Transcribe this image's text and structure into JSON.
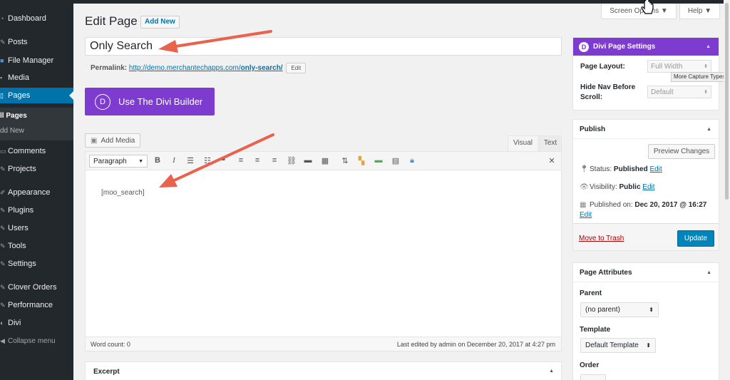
{
  "sidebar": {
    "items": [
      {
        "label": "Dashboard",
        "icon": "dashboard-icon"
      },
      {
        "label": "Posts",
        "icon": "pin-icon"
      },
      {
        "label": "File Manager",
        "icon": "folder-icon"
      },
      {
        "label": "Media",
        "icon": "media-icon"
      },
      {
        "label": "Pages",
        "icon": "pages-icon",
        "active": true
      },
      {
        "label": "Comments",
        "icon": "comment-icon"
      },
      {
        "label": "Projects",
        "icon": "projects-icon"
      },
      {
        "label": "Appearance",
        "icon": "brush-icon"
      },
      {
        "label": "Plugins",
        "icon": "plugin-icon"
      },
      {
        "label": "Users",
        "icon": "users-icon"
      },
      {
        "label": "Tools",
        "icon": "wrench-icon"
      },
      {
        "label": "Settings",
        "icon": "settings-icon"
      },
      {
        "label": "Clover Orders",
        "icon": "clover-icon"
      },
      {
        "label": "Performance",
        "icon": "performance-icon"
      },
      {
        "label": "Divi",
        "icon": "divi-icon"
      },
      {
        "label": "Collapse menu",
        "icon": "collapse-icon"
      }
    ],
    "submenu": [
      "ll Pages",
      "dd New"
    ]
  },
  "header": {
    "title": "Edit Page",
    "add_new": "Add New",
    "screen_options": "Screen Options ▼",
    "help": "Help ▼"
  },
  "post": {
    "title": "Only Search",
    "permalink_label": "Permalink:",
    "permalink_base": "http://demo.merchantechapps.com/",
    "permalink_slug": "only-search/",
    "permalink_edit": "Edit"
  },
  "divi_builder": {
    "logo": "D",
    "label": "Use The Divi Builder"
  },
  "editor": {
    "add_media": "Add Media",
    "tab_visual": "Visual",
    "tab_text": "Text",
    "format_select": "Paragraph",
    "content": "[moo_search]",
    "word_count": "Word count: 0",
    "last_edited": "Last edited by admin on December 20, 2017 at 4:27 pm"
  },
  "excerpt": {
    "title": "Excerpt"
  },
  "divi_settings": {
    "logo": "D",
    "title": "Divi Page Settings",
    "layout_label": "Page Layout:",
    "layout_value": "Full Width",
    "hide_nav_label_1": "Hide Nav Before",
    "hide_nav_label_2": "Scroll:",
    "hide_nav_value": "Default",
    "tooltip": "More Capture Types"
  },
  "publish": {
    "title": "Publish",
    "preview": "Preview Changes",
    "status_label": "Status:",
    "status_value": "Published",
    "visibility_label": "Visibility:",
    "visibility_value": "Public",
    "published_label": "Published on:",
    "published_value": "Dec 20, 2017 @ 16:27",
    "edit": "Edit",
    "trash": "Move to Trash",
    "update": "Update"
  },
  "attributes": {
    "title": "Page Attributes",
    "parent_label": "Parent",
    "parent_value": "(no parent)",
    "template_label": "Template",
    "template_value": "Default Template",
    "order_label": "Order"
  },
  "colors": {
    "sidebar": "#23282d",
    "accent": "#0073aa",
    "divi": "#7e3bd0",
    "arrow": "#e8624e"
  }
}
